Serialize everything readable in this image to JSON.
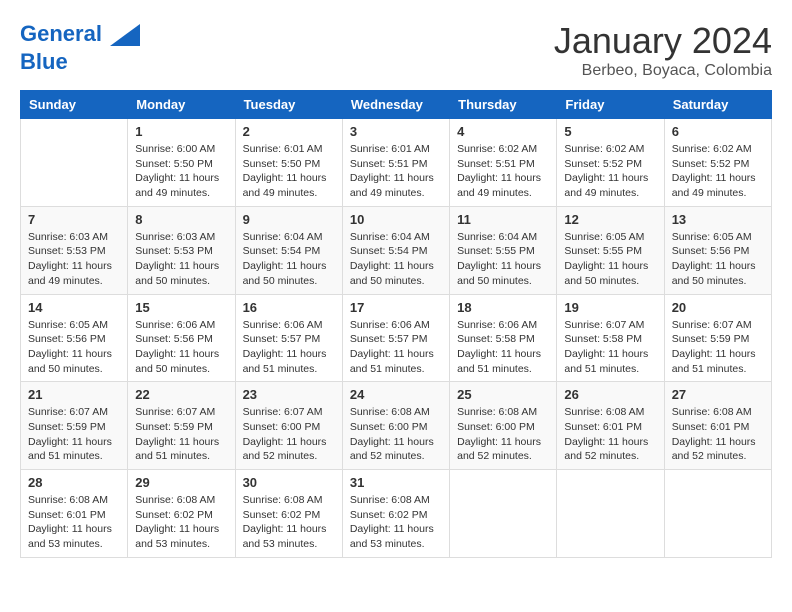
{
  "logo": {
    "line1": "General",
    "line2": "Blue"
  },
  "title": "January 2024",
  "subtitle": "Berbeo, Boyaca, Colombia",
  "days_header": [
    "Sunday",
    "Monday",
    "Tuesday",
    "Wednesday",
    "Thursday",
    "Friday",
    "Saturday"
  ],
  "weeks": [
    [
      {
        "day": "",
        "sunrise": "",
        "sunset": "",
        "daylight": ""
      },
      {
        "day": "1",
        "sunrise": "6:00 AM",
        "sunset": "5:50 PM",
        "daylight": "11 hours and 49 minutes."
      },
      {
        "day": "2",
        "sunrise": "6:01 AM",
        "sunset": "5:50 PM",
        "daylight": "11 hours and 49 minutes."
      },
      {
        "day": "3",
        "sunrise": "6:01 AM",
        "sunset": "5:51 PM",
        "daylight": "11 hours and 49 minutes."
      },
      {
        "day": "4",
        "sunrise": "6:02 AM",
        "sunset": "5:51 PM",
        "daylight": "11 hours and 49 minutes."
      },
      {
        "day": "5",
        "sunrise": "6:02 AM",
        "sunset": "5:52 PM",
        "daylight": "11 hours and 49 minutes."
      },
      {
        "day": "6",
        "sunrise": "6:02 AM",
        "sunset": "5:52 PM",
        "daylight": "11 hours and 49 minutes."
      }
    ],
    [
      {
        "day": "7",
        "sunrise": "6:03 AM",
        "sunset": "5:53 PM",
        "daylight": "11 hours and 49 minutes."
      },
      {
        "day": "8",
        "sunrise": "6:03 AM",
        "sunset": "5:53 PM",
        "daylight": "11 hours and 50 minutes."
      },
      {
        "day": "9",
        "sunrise": "6:04 AM",
        "sunset": "5:54 PM",
        "daylight": "11 hours and 50 minutes."
      },
      {
        "day": "10",
        "sunrise": "6:04 AM",
        "sunset": "5:54 PM",
        "daylight": "11 hours and 50 minutes."
      },
      {
        "day": "11",
        "sunrise": "6:04 AM",
        "sunset": "5:55 PM",
        "daylight": "11 hours and 50 minutes."
      },
      {
        "day": "12",
        "sunrise": "6:05 AM",
        "sunset": "5:55 PM",
        "daylight": "11 hours and 50 minutes."
      },
      {
        "day": "13",
        "sunrise": "6:05 AM",
        "sunset": "5:56 PM",
        "daylight": "11 hours and 50 minutes."
      }
    ],
    [
      {
        "day": "14",
        "sunrise": "6:05 AM",
        "sunset": "5:56 PM",
        "daylight": "11 hours and 50 minutes."
      },
      {
        "day": "15",
        "sunrise": "6:06 AM",
        "sunset": "5:56 PM",
        "daylight": "11 hours and 50 minutes."
      },
      {
        "day": "16",
        "sunrise": "6:06 AM",
        "sunset": "5:57 PM",
        "daylight": "11 hours and 51 minutes."
      },
      {
        "day": "17",
        "sunrise": "6:06 AM",
        "sunset": "5:57 PM",
        "daylight": "11 hours and 51 minutes."
      },
      {
        "day": "18",
        "sunrise": "6:06 AM",
        "sunset": "5:58 PM",
        "daylight": "11 hours and 51 minutes."
      },
      {
        "day": "19",
        "sunrise": "6:07 AM",
        "sunset": "5:58 PM",
        "daylight": "11 hours and 51 minutes."
      },
      {
        "day": "20",
        "sunrise": "6:07 AM",
        "sunset": "5:59 PM",
        "daylight": "11 hours and 51 minutes."
      }
    ],
    [
      {
        "day": "21",
        "sunrise": "6:07 AM",
        "sunset": "5:59 PM",
        "daylight": "11 hours and 51 minutes."
      },
      {
        "day": "22",
        "sunrise": "6:07 AM",
        "sunset": "5:59 PM",
        "daylight": "11 hours and 51 minutes."
      },
      {
        "day": "23",
        "sunrise": "6:07 AM",
        "sunset": "6:00 PM",
        "daylight": "11 hours and 52 minutes."
      },
      {
        "day": "24",
        "sunrise": "6:08 AM",
        "sunset": "6:00 PM",
        "daylight": "11 hours and 52 minutes."
      },
      {
        "day": "25",
        "sunrise": "6:08 AM",
        "sunset": "6:00 PM",
        "daylight": "11 hours and 52 minutes."
      },
      {
        "day": "26",
        "sunrise": "6:08 AM",
        "sunset": "6:01 PM",
        "daylight": "11 hours and 52 minutes."
      },
      {
        "day": "27",
        "sunrise": "6:08 AM",
        "sunset": "6:01 PM",
        "daylight": "11 hours and 52 minutes."
      }
    ],
    [
      {
        "day": "28",
        "sunrise": "6:08 AM",
        "sunset": "6:01 PM",
        "daylight": "11 hours and 53 minutes."
      },
      {
        "day": "29",
        "sunrise": "6:08 AM",
        "sunset": "6:02 PM",
        "daylight": "11 hours and 53 minutes."
      },
      {
        "day": "30",
        "sunrise": "6:08 AM",
        "sunset": "6:02 PM",
        "daylight": "11 hours and 53 minutes."
      },
      {
        "day": "31",
        "sunrise": "6:08 AM",
        "sunset": "6:02 PM",
        "daylight": "11 hours and 53 minutes."
      },
      {
        "day": "",
        "sunrise": "",
        "sunset": "",
        "daylight": ""
      },
      {
        "day": "",
        "sunrise": "",
        "sunset": "",
        "daylight": ""
      },
      {
        "day": "",
        "sunrise": "",
        "sunset": "",
        "daylight": ""
      }
    ]
  ]
}
